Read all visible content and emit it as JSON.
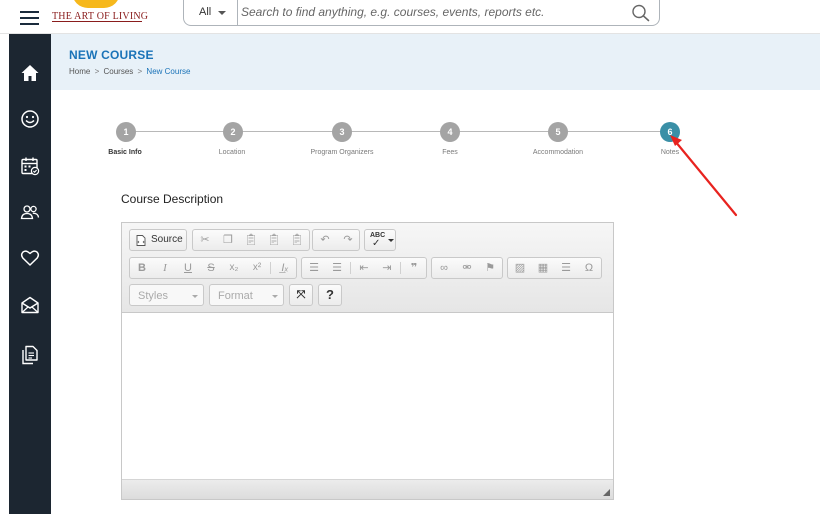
{
  "header": {
    "logo_text": "THE ART OF LIVING",
    "search": {
      "scope": "All",
      "placeholder": "Search to find anything, e.g. courses, events, reports etc."
    }
  },
  "sidebar": {
    "items": [
      {
        "name": "home-icon"
      },
      {
        "name": "smiley-icon"
      },
      {
        "name": "calendar-icon"
      },
      {
        "name": "people-icon"
      },
      {
        "name": "heart-icon"
      },
      {
        "name": "mail-icon"
      },
      {
        "name": "documents-icon"
      }
    ]
  },
  "page": {
    "title": "NEW COURSE",
    "breadcrumb": {
      "home": "Home",
      "courses": "Courses",
      "current": "New Course",
      "separator": ">"
    }
  },
  "stepper": {
    "steps": [
      {
        "number": "1",
        "label": "Basic Info",
        "bold": true,
        "active": false
      },
      {
        "number": "2",
        "label": "Location",
        "bold": false,
        "active": false
      },
      {
        "number": "3",
        "label": "Program Organizers",
        "bold": false,
        "active": false
      },
      {
        "number": "4",
        "label": "Fees",
        "bold": false,
        "active": false
      },
      {
        "number": "5",
        "label": "Accommodation",
        "bold": false,
        "active": false
      },
      {
        "number": "6",
        "label": "Notes",
        "bold": false,
        "active": true
      }
    ]
  },
  "editor": {
    "section_title": "Course Description",
    "source_label": "Source",
    "styles_placeholder": "Styles",
    "format_placeholder": "Format",
    "content": ""
  },
  "colors": {
    "accent": "#1a73b8",
    "sidebar_bg": "#1c2631",
    "header_band": "#e8f1f8",
    "active_step": "#3a8fa6",
    "inactive_step": "#a4a4a4",
    "annotation_arrow": "#e8231f"
  }
}
